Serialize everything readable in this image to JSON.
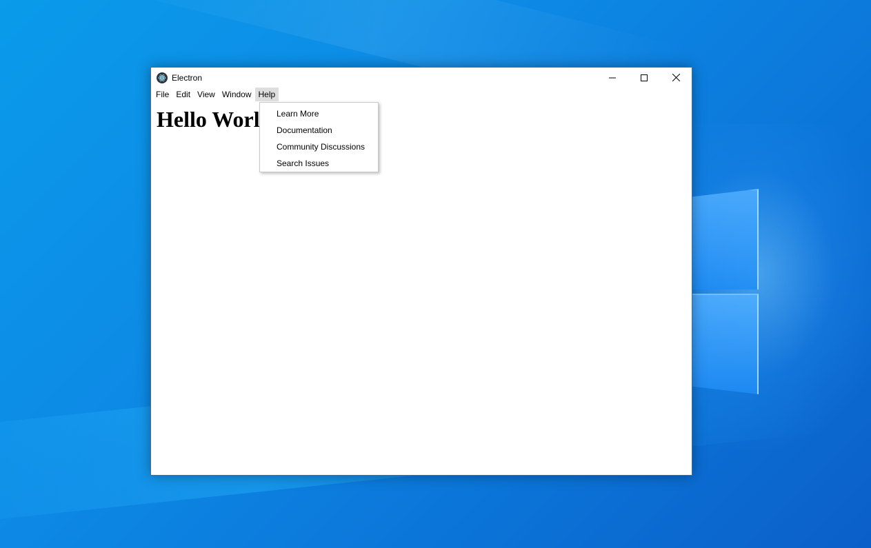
{
  "window": {
    "title": "Electron",
    "icon": "electron-logo-icon",
    "controls": [
      "minimize-icon",
      "maximize-icon",
      "close-icon"
    ]
  },
  "menubar": {
    "items": [
      {
        "label": "File"
      },
      {
        "label": "Edit"
      },
      {
        "label": "View"
      },
      {
        "label": "Window"
      },
      {
        "label": "Help",
        "active": true
      }
    ]
  },
  "content": {
    "heading": "Hello World"
  },
  "help_menu": {
    "items": [
      {
        "label": "Learn More"
      },
      {
        "label": "Documentation"
      },
      {
        "label": "Community Discussions"
      },
      {
        "label": "Search Issues"
      }
    ]
  },
  "colors": {
    "desktop_bg": "#0b84e3",
    "menu_active_bg": "#dedede",
    "window_border": "#3a6ea5"
  }
}
